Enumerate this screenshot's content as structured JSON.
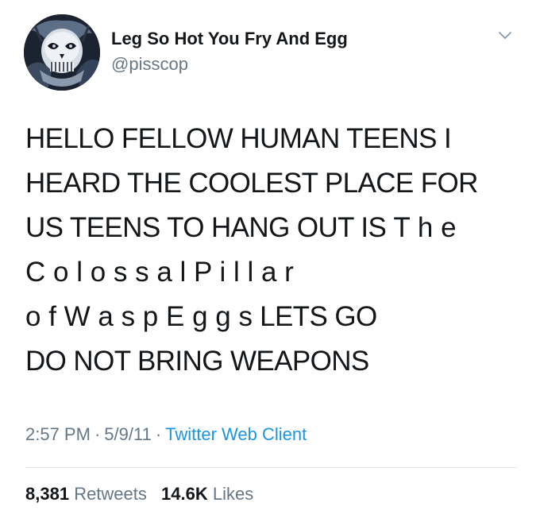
{
  "tweet": {
    "avatar_icon": "skull-avatar",
    "display_name": "Leg So Hot You Fry And Egg",
    "handle": "@pisscop",
    "menu_icon": "chevron-down-icon",
    "text_lines": [
      "HELLO FELLOW HUMAN TEENS I",
      "HEARD THE COOLEST PLACE FOR",
      "US TEENS TO HANG OUT IS ",
      "C o l o s s a l  P i l l a r",
      "o f  W a s p  E g g s",
      "DO NOT BRING WEAPONS"
    ],
    "spaced_the": "T h e",
    "lets_go": " LETS GO",
    "time": "2:57 PM",
    "date": "5/9/11",
    "separator": "·",
    "client": "Twitter Web Client",
    "retweets_count": "8,381",
    "retweets_label": "Retweets",
    "likes_count": "14.6K",
    "likes_label": "Likes"
  },
  "colors": {
    "text": "#14171a",
    "secondary": "#657786",
    "link": "#1b95e0",
    "divider": "#e1e8ed"
  }
}
